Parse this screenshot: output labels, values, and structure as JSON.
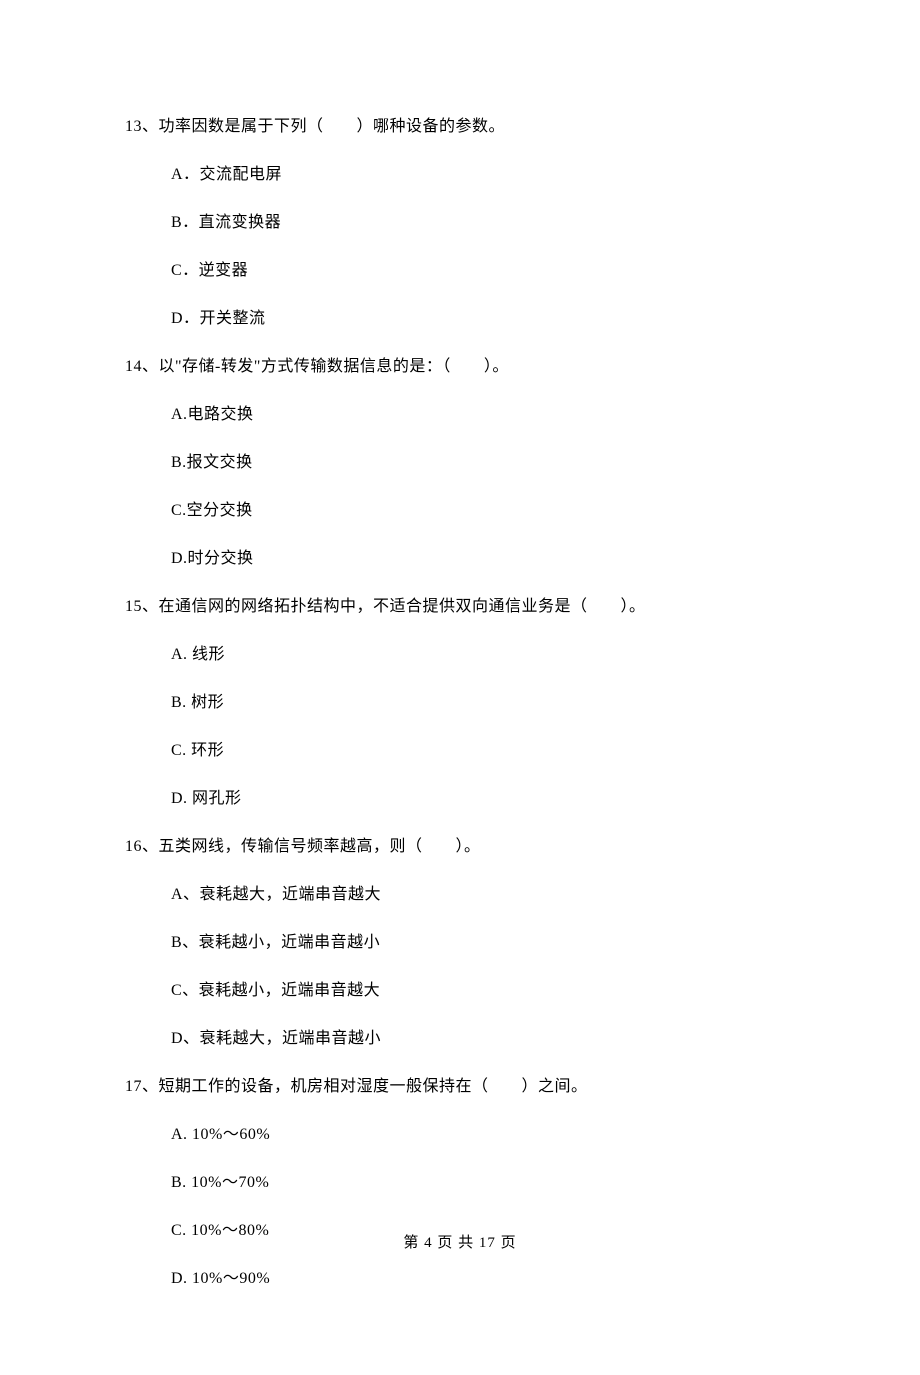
{
  "questions": [
    {
      "stem": "13、功率因数是属于下列（　　）哪种设备的参数。",
      "options": [
        "A．交流配电屏",
        "B．直流变换器",
        "C．逆变器",
        "D．开关整流"
      ]
    },
    {
      "stem": "14、以\"存储-转发\"方式传输数据信息的是：（　　）。",
      "options": [
        "A.电路交换",
        "B.报文交换",
        "C.空分交换",
        "D.时分交换"
      ]
    },
    {
      "stem": "15、在通信网的网络拓扑结构中，不适合提供双向通信业务是（　　）。",
      "options": [
        "A.  线形",
        "B.  树形",
        "C.  环形",
        "D.  网孔形"
      ]
    },
    {
      "stem": "16、五类网线，传输信号频率越高，则（　　）。",
      "options": [
        "A、衰耗越大，近端串音越大",
        "B、衰耗越小，近端串音越小",
        "C、衰耗越小，近端串音越大",
        "D、衰耗越大，近端串音越小"
      ]
    },
    {
      "stem": "17、短期工作的设备，机房相对湿度一般保持在（　　）之间。",
      "options": [
        "A.  10%～60%",
        "B.  10%～70%",
        "C.  10%～80%",
        "D.  10%～90%"
      ]
    }
  ],
  "footer": "第 4 页 共 17 页"
}
